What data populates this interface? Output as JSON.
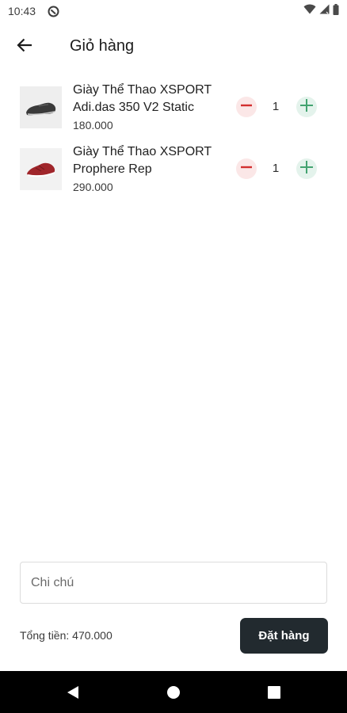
{
  "status_bar": {
    "time": "10:43",
    "icons": [
      "app-notification-icon",
      "wifi-icon",
      "signal-icon",
      "battery-icon"
    ]
  },
  "app_bar": {
    "title": "Giỏ hàng",
    "back_icon": "arrow-left-icon"
  },
  "cart": {
    "items": [
      {
        "name": "Giày Thể Thao XSPORT Adi.das 350 V2 Static",
        "price": "180.000",
        "quantity": "1",
        "image": "shoe-thumbnail-grey"
      },
      {
        "name": "Giày Thể Thao XSPORT Prophere Rep",
        "price": "290.000",
        "quantity": "1",
        "image": "shoe-thumbnail-red"
      }
    ],
    "minus_icon": "minus-icon",
    "plus_icon": "plus-icon"
  },
  "note": {
    "placeholder": "Chi chú",
    "value": ""
  },
  "footer": {
    "total_label": "Tổng tiền: 470.000",
    "order_button": "Đặt hàng"
  },
  "nav_bar": {
    "icons": [
      "nav-back-icon",
      "nav-home-icon",
      "nav-recents-icon"
    ]
  },
  "colors": {
    "minus_bg": "#fbe7e7",
    "minus_fg": "#d32f2f",
    "plus_bg": "#e4f3ec",
    "plus_fg": "#43a370",
    "order_button_bg": "#222a2f",
    "nav_bar_bg": "#000000"
  }
}
